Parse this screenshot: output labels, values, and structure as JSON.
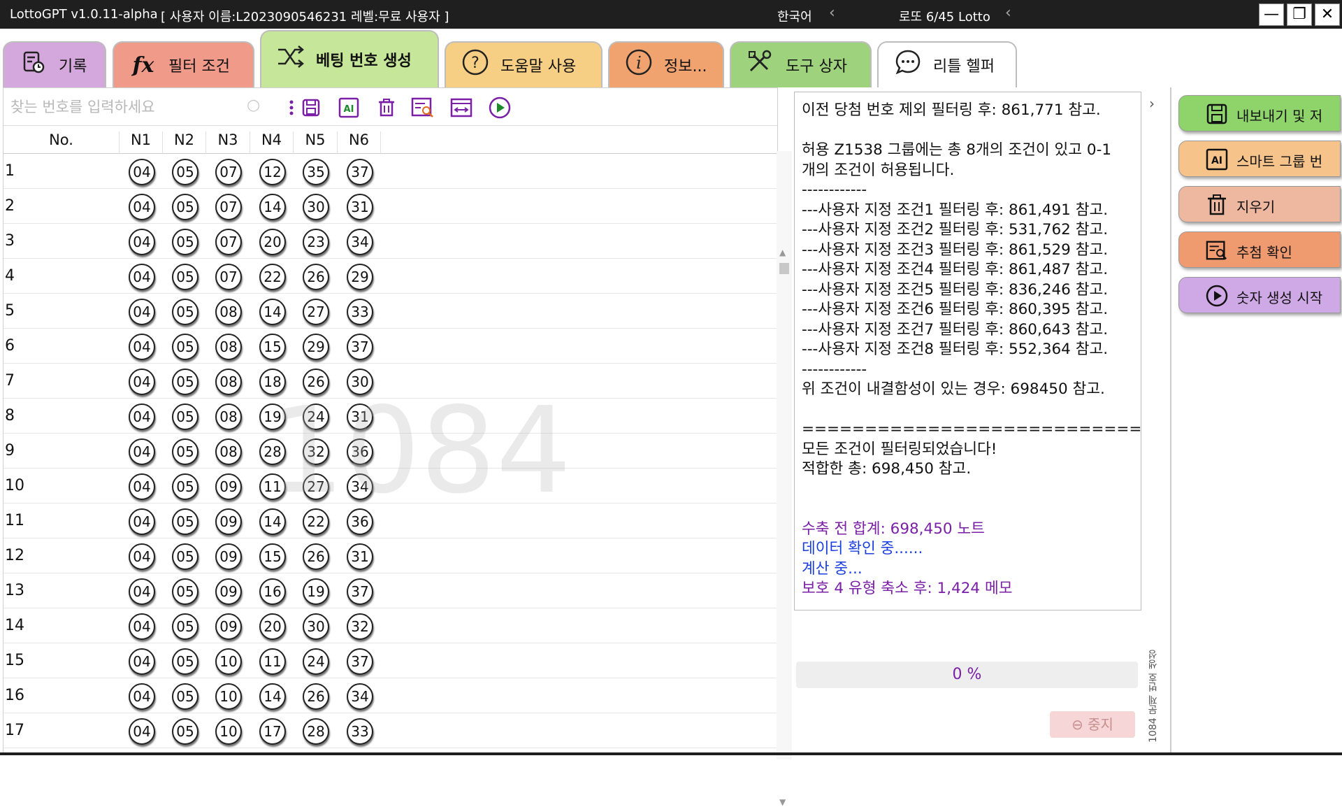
{
  "window": {
    "app_title": "LottoGPT v1.0.11-alpha",
    "user_info": "[ 사용자 이름:L2023090546231   레벨:무료 사용자 ]",
    "language": "한국어",
    "lottery": "로또 6/45 Lotto",
    "minimize": "—",
    "restore": "❐",
    "close": "✕"
  },
  "tabs": [
    {
      "label": "기록",
      "icon": "history-icon",
      "color": "#d4a8dc"
    },
    {
      "label": "필터 조건",
      "icon": "fx-icon",
      "color": "#f09a8a"
    },
    {
      "label": "베팅 번호 생성",
      "icon": "shuffle-icon",
      "color": "#c6e69a"
    },
    {
      "label": "도움말 사용",
      "icon": "help-icon",
      "color": "#f6cf84"
    },
    {
      "label": "정보...",
      "icon": "info-icon",
      "color": "#f0a36e"
    },
    {
      "label": "도구 상자",
      "icon": "tools-icon",
      "color": "#9fd27c"
    },
    {
      "label": "리틀 헬퍼",
      "icon": "chat-icon",
      "color": "#ffffff"
    }
  ],
  "search": {
    "placeholder": "찾는 번호를 입력하세요"
  },
  "grid": {
    "headers": [
      "No.",
      "N1",
      "N2",
      "N3",
      "N4",
      "N5",
      "N6"
    ],
    "rows": [
      {
        "no": "1",
        "nums": [
          "04",
          "05",
          "07",
          "12",
          "35",
          "37"
        ]
      },
      {
        "no": "2",
        "nums": [
          "04",
          "05",
          "07",
          "14",
          "30",
          "31"
        ]
      },
      {
        "no": "3",
        "nums": [
          "04",
          "05",
          "07",
          "20",
          "23",
          "34"
        ]
      },
      {
        "no": "4",
        "nums": [
          "04",
          "05",
          "07",
          "22",
          "26",
          "29"
        ]
      },
      {
        "no": "5",
        "nums": [
          "04",
          "05",
          "08",
          "14",
          "27",
          "33"
        ]
      },
      {
        "no": "6",
        "nums": [
          "04",
          "05",
          "08",
          "15",
          "29",
          "37"
        ]
      },
      {
        "no": "7",
        "nums": [
          "04",
          "05",
          "08",
          "18",
          "26",
          "30"
        ]
      },
      {
        "no": "8",
        "nums": [
          "04",
          "05",
          "08",
          "19",
          "24",
          "31"
        ]
      },
      {
        "no": "9",
        "nums": [
          "04",
          "05",
          "08",
          "28",
          "32",
          "36"
        ]
      },
      {
        "no": "10",
        "nums": [
          "04",
          "05",
          "09",
          "11",
          "27",
          "34"
        ]
      },
      {
        "no": "11",
        "nums": [
          "04",
          "05",
          "09",
          "14",
          "22",
          "36"
        ]
      },
      {
        "no": "12",
        "nums": [
          "04",
          "05",
          "09",
          "15",
          "26",
          "31"
        ]
      },
      {
        "no": "13",
        "nums": [
          "04",
          "05",
          "09",
          "16",
          "19",
          "37"
        ]
      },
      {
        "no": "14",
        "nums": [
          "04",
          "05",
          "09",
          "20",
          "30",
          "32"
        ]
      },
      {
        "no": "15",
        "nums": [
          "04",
          "05",
          "10",
          "11",
          "24",
          "37"
        ]
      },
      {
        "no": "16",
        "nums": [
          "04",
          "05",
          "10",
          "14",
          "26",
          "34"
        ]
      },
      {
        "no": "17",
        "nums": [
          "04",
          "05",
          "10",
          "17",
          "28",
          "33"
        ]
      }
    ],
    "watermark": "1084"
  },
  "log": [
    {
      "text": "이전 당첨 번호 제외 필터링 후: 861,771 참고.",
      "style": ""
    },
    {
      "text": "",
      "style": "empty"
    },
    {
      "text": "허용 Z1538 그룹에는 총 8개의 조건이 있고 0-1",
      "style": ""
    },
    {
      "text": "개의 조건이 허용됩니다.",
      "style": ""
    },
    {
      "text": "------------",
      "style": ""
    },
    {
      "text": "---사용자 지정 조건1 필터링 후: 861,491 참고.",
      "style": ""
    },
    {
      "text": "---사용자 지정 조건2 필터링 후: 531,762 참고.",
      "style": ""
    },
    {
      "text": "---사용자 지정 조건3 필터링 후: 861,529 참고.",
      "style": ""
    },
    {
      "text": "---사용자 지정 조건4 필터링 후: 861,487 참고.",
      "style": ""
    },
    {
      "text": "---사용자 지정 조건5 필터링 후: 836,246 참고.",
      "style": ""
    },
    {
      "text": "---사용자 지정 조건6 필터링 후: 860,395 참고.",
      "style": ""
    },
    {
      "text": "---사용자 지정 조건7 필터링 후: 860,643 참고.",
      "style": ""
    },
    {
      "text": "---사용자 지정 조건8 필터링 후: 552,364 참고.",
      "style": ""
    },
    {
      "text": "------------",
      "style": ""
    },
    {
      "text": "위 조건이 내결함성이 있는 경우: 698450 참고.",
      "style": ""
    },
    {
      "text": "",
      "style": "empty"
    },
    {
      "text": "============================",
      "style": ""
    },
    {
      "text": "모든 조건이 필터링되었습니다!",
      "style": ""
    },
    {
      "text": "적합한 총: 698,450 참고.",
      "style": ""
    },
    {
      "text": "",
      "style": "empty"
    },
    {
      "text": "",
      "style": "empty"
    },
    {
      "text": "수축 전 합계: 698,450 노트",
      "style": "purple"
    },
    {
      "text": "데이터 확인 중......",
      "style": "blue"
    },
    {
      "text": "계산 중...",
      "style": "blue"
    },
    {
      "text": "보호 4 유형 축소 후: 1,424 메모",
      "style": "purple"
    }
  ],
  "progress": {
    "label": "0 %",
    "value": 0
  },
  "stop_label": "⊖ 중지",
  "vertical_status": "1084 문제 번호 생성",
  "actions": [
    {
      "label": "내보내기 및 저",
      "icon": "save-icon",
      "color": "#8fd46a"
    },
    {
      "label": "스마트 그룹 번",
      "icon": "ai-icon",
      "color": "#f6c48a"
    },
    {
      "label": "지우기",
      "icon": "trash-icon",
      "color": "#eeb8a0"
    },
    {
      "label": "추첨 확인",
      "icon": "check-draw-icon",
      "color": "#f09a70"
    },
    {
      "label": "숫자 생성 시작",
      "icon": "play-icon",
      "color": "#cfa8e6"
    }
  ]
}
